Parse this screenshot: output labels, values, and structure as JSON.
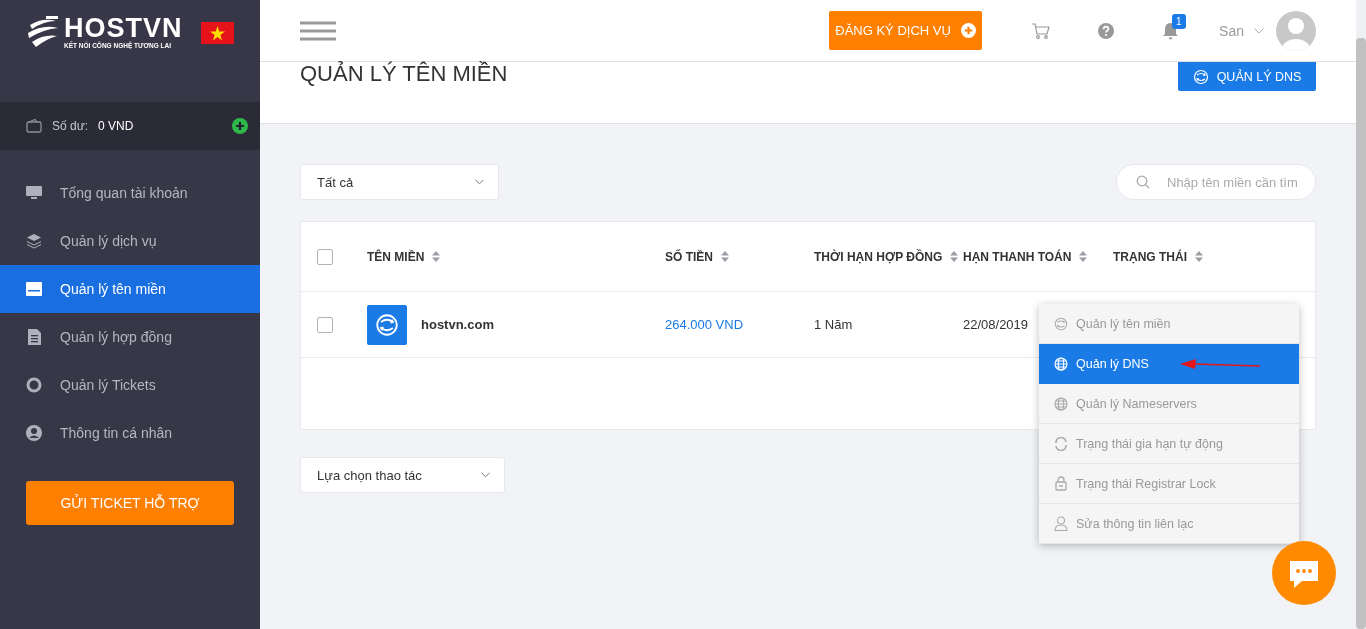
{
  "brand": {
    "name": "HOSTVN",
    "tagline": "KẾT NỐI CÔNG NGHỆ TƯƠNG LAI"
  },
  "balance": {
    "label": "Số dư:",
    "value": "0 VND"
  },
  "sidebar": {
    "items": [
      {
        "label": "Tổng quan tài khoản",
        "selected": false
      },
      {
        "label": "Quản lý dịch vụ",
        "selected": false
      },
      {
        "label": "Quản lý tên miền",
        "selected": true
      },
      {
        "label": "Quản lý hợp đồng",
        "selected": false
      },
      {
        "label": "Quản lý Tickets",
        "selected": false
      },
      {
        "label": "Thông tin cá nhân",
        "selected": false
      }
    ],
    "support_button": "GỬI TICKET HỖ TRỢ"
  },
  "header": {
    "register_button": "ĐĂNG KÝ DỊCH VỤ",
    "notification_count": "1",
    "user": "San"
  },
  "page": {
    "title": "QUẢN LÝ TÊN MIỀN",
    "dns_button": "QUẢN LÝ DNS"
  },
  "filter": {
    "value": "Tất cả"
  },
  "search": {
    "placeholder": "Nhập tên miền cần tìm"
  },
  "table": {
    "all_checked": false,
    "columns": [
      "TÊN MIỀN",
      "SỐ TIỀN",
      "THỜI HẠN HỢP ĐỒNG",
      "HẠN THANH TOÁN",
      "TRẠNG THÁI"
    ],
    "rows": [
      {
        "checked": false,
        "domain": "hostvn.com",
        "amount": "264.000 VND",
        "term": "1 Năm",
        "due": "22/08/2019"
      }
    ]
  },
  "bulk_action": {
    "value": "Lựa chọn thao tác"
  },
  "action_menu": {
    "items": [
      {
        "label": "Quản lý tên miền",
        "selected": false
      },
      {
        "label": "Quản lý DNS",
        "selected": true
      },
      {
        "label": "Quản lý Nameservers",
        "selected": false
      },
      {
        "label": "Trạng thái gia hạn tự động",
        "selected": false
      },
      {
        "label": "Trạng thái Registrar Lock",
        "selected": false
      },
      {
        "label": "Sửa thông tin liên lạc",
        "selected": false
      }
    ]
  }
}
